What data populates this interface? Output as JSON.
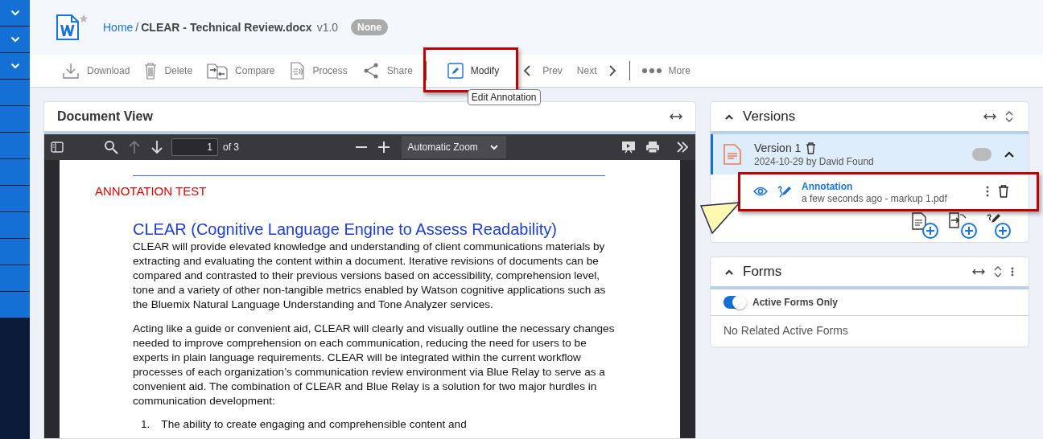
{
  "sidebar": {
    "items": [
      {
        "kind": "chevron"
      },
      {
        "kind": "chevron"
      },
      {
        "kind": "chevron"
      },
      {
        "kind": "blank"
      },
      {
        "kind": "blank"
      },
      {
        "kind": "blank"
      },
      {
        "kind": "blank"
      },
      {
        "kind": "blank"
      },
      {
        "kind": "blank"
      },
      {
        "kind": "blank"
      },
      {
        "kind": "blank"
      },
      {
        "kind": "blank"
      }
    ]
  },
  "header": {
    "starred": false,
    "home": "Home",
    "separator": "/",
    "title": "CLEAR - Technical Review.docx",
    "version": "v1.0",
    "badge": "None"
  },
  "toolbar": {
    "items": [
      {
        "kind": "download",
        "label": "Download",
        "highlighted": false
      },
      {
        "kind": "delete",
        "label": "Delete",
        "highlighted": false
      },
      {
        "kind": "compare",
        "label": "Compare",
        "highlighted": false
      },
      {
        "kind": "process",
        "label": "Process",
        "highlighted": false
      },
      {
        "kind": "share",
        "label": "Share",
        "highlighted": false
      },
      {
        "kind": "separator"
      },
      {
        "kind": "modify",
        "label": "Modify",
        "highlighted": true
      },
      {
        "kind": "prev",
        "label": "Prev",
        "highlighted": false
      },
      {
        "kind": "next",
        "label": "Next",
        "highlighted": false
      },
      {
        "kind": "separator"
      },
      {
        "kind": "more",
        "label": "More",
        "highlighted": false
      }
    ],
    "tooltip": "Edit Annotation"
  },
  "document_view": {
    "title": "Document View",
    "pdf_toolbar": {
      "page": "1",
      "page_count": "of 3",
      "zoom": "Automatic Zoom"
    },
    "page": {
      "note": "ANNOTATION TEST",
      "heading": "CLEAR (Cognitive Language Engine to Assess Readability)",
      "paragraphs": [
        "CLEAR will provide elevated knowledge and understanding of client communications materials by extracting and evaluating the content within a document. Iterative revisions of documents can be compared and contrasted to their previous versions based on accessibility, comprehension level, tone and a variety of other non-tangible metrics enabled by Watson cognitive applications such as the Bluemix Natural Language Understanding and Tone Analyzer services.",
        "Acting like a guide or convenient aid, CLEAR will clearly and visually outline the necessary changes needed to improve comprehension on each communication, reducing the need for users to be experts in plain language requirements. CLEAR will be integrated within the current workflow processes of each organization’s communication review environment via Blue Relay to serve as a convenient aid. The combination of CLEAR and Blue Relay is a solution for two major hurdles in communication development:"
      ],
      "list": [
        {
          "number": "1.",
          "text": "The ability to create engaging and comprehensible content and"
        }
      ]
    }
  },
  "versions": {
    "title": "Versions",
    "items": [
      {
        "name": "Version 1",
        "meta": "2024-10-29 by David Found",
        "selected": true,
        "expanded": true,
        "on": false,
        "annotations": [
          {
            "title": "Annotation",
            "meta": "a few seconds ago - markup 1.pdf",
            "highlighted": true
          }
        ]
      }
    ]
  },
  "forms": {
    "title": "Forms",
    "toggle": {
      "label": "Active Forms Only",
      "on": true
    },
    "empty": "No Related Active Forms"
  }
}
